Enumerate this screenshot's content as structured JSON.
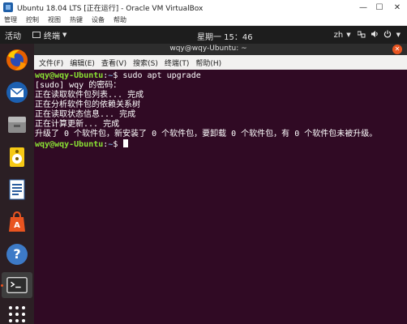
{
  "host": {
    "title": "Ubuntu 18.04 LTS [正在运行] - Oracle VM VirtualBox",
    "menu": [
      "管理",
      "控制",
      "视图",
      "热键",
      "设备",
      "帮助"
    ]
  },
  "topbar": {
    "activities": "活动",
    "app_name": "终端",
    "clock": "星期一 15：46",
    "lang": "zh"
  },
  "terminal": {
    "title": "wqy@wqy-Ubuntu: ~",
    "menu": [
      "文件(F)",
      "编辑(E)",
      "查看(V)",
      "搜索(S)",
      "终端(T)",
      "帮助(H)"
    ],
    "prompt_user": "wqy@wqy-Ubuntu",
    "prompt_path": "~",
    "command": "sudo apt upgrade",
    "output": [
      "[sudo] wqy 的密码：",
      "正在读取软件包列表... 完成",
      "正在分析软件包的依赖关系树",
      "正在读取状态信息... 完成",
      "正在计算更新... 完成",
      "升级了 0 个软件包，新安装了 0 个软件包，要卸载 0 个软件包，有 0 个软件包未被升级。"
    ]
  },
  "dock": {
    "items": [
      "firefox-icon",
      "thunderbird-icon",
      "files-icon",
      "rhythmbox-icon",
      "writer-icon",
      "software-icon",
      "help-icon",
      "terminal-icon",
      "app-grid-icon"
    ]
  }
}
